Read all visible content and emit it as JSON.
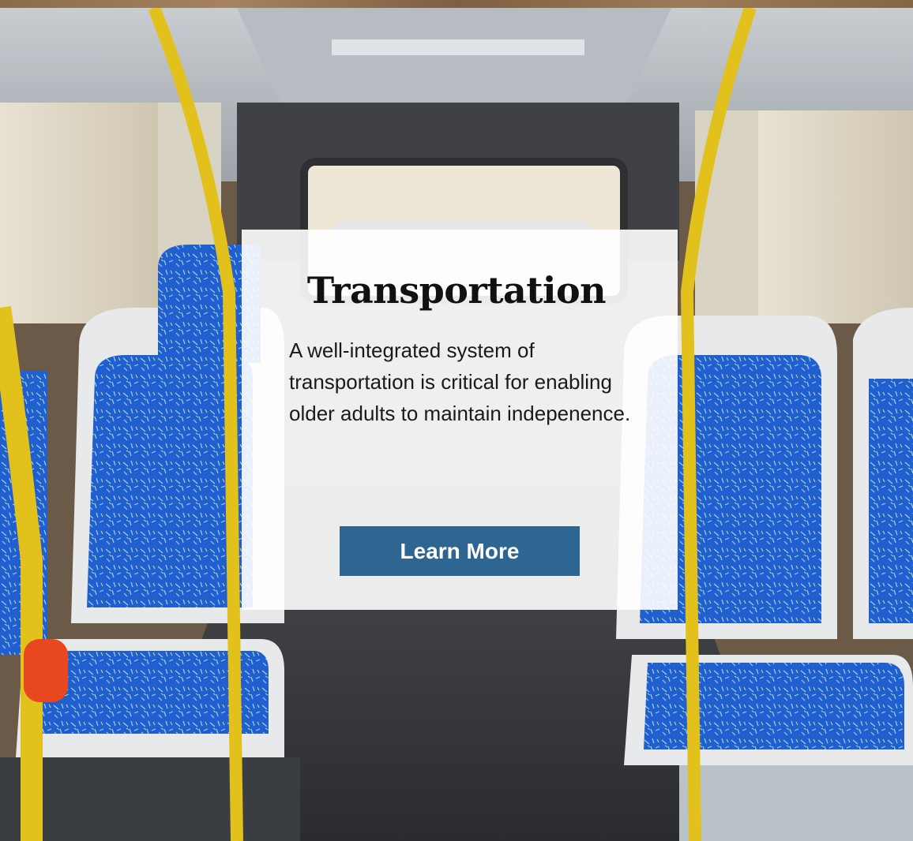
{
  "card": {
    "title": "Transportation",
    "description": "A well-integrated system of transportation is critical for enabling older adults to maintain indepenence.",
    "button_label": "Learn More"
  },
  "colors": {
    "button_bg": "#2f6591",
    "button_text": "#ffffff",
    "card_bg": "#ffffff",
    "seat_blue": "#1f5fd0",
    "pole_yellow": "#e2c11c"
  }
}
